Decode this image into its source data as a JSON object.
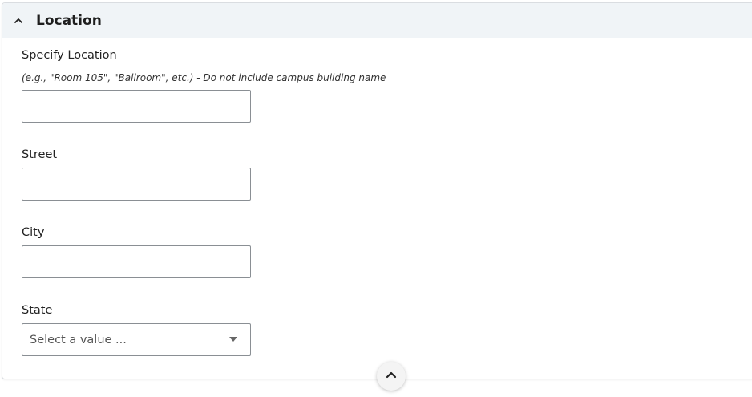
{
  "section": {
    "title": "Location",
    "collapse_icon": "chevron-up-icon"
  },
  "fields": {
    "specify_location": {
      "label": "Specify Location",
      "hint": "(e.g., \"Room 105\", \"Ballroom\", etc.) - Do not include campus building name",
      "value": ""
    },
    "street": {
      "label": "Street",
      "value": ""
    },
    "city": {
      "label": "City",
      "value": ""
    },
    "state": {
      "label": "State",
      "selected": "Select a value ...",
      "dropdown_icon": "caret-down-icon"
    }
  },
  "scroll_top": {
    "icon": "chevron-up-icon"
  }
}
